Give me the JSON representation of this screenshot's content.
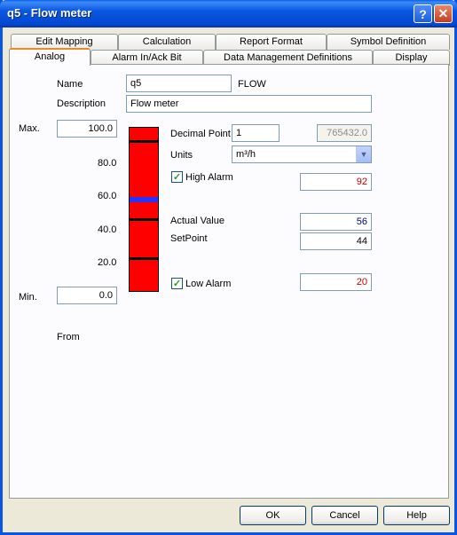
{
  "window": {
    "title": "q5 - Flow meter"
  },
  "tabs_row1": [
    {
      "label": "Edit Mapping"
    },
    {
      "label": "Calculation"
    },
    {
      "label": "Report Format"
    },
    {
      "label": "Symbol Definition"
    }
  ],
  "tabs_row2": [
    {
      "label": "Analog",
      "active": true
    },
    {
      "label": "Alarm In/Ack Bit"
    },
    {
      "label": "Data Management Definitions"
    },
    {
      "label": "Display"
    }
  ],
  "form": {
    "name_label": "Name",
    "name_value": "q5",
    "name_suffix": "FLOW",
    "description_label": "Description",
    "description_value": "Flow meter",
    "max_label": "Max.",
    "max_value": "100.0",
    "min_label": "Min.",
    "min_value": "0.0",
    "scale_ticks": [
      "80.0",
      "60.0",
      "40.0",
      "20.0"
    ],
    "decimal_point_label": "Decimal Point",
    "decimal_point_value": "1",
    "decimal_preview": "765432.0",
    "units_label": "Units",
    "units_value": "m³/h",
    "high_alarm_label": "High Alarm",
    "high_alarm_checked": true,
    "high_alarm_value": "92",
    "actual_value_label": "Actual Value",
    "actual_value": "56",
    "setpoint_label": "SetPoint",
    "setpoint_value": "44",
    "low_alarm_label": "Low Alarm",
    "low_alarm_checked": true,
    "low_alarm_value": "20",
    "from_label": "From"
  },
  "gauge": {
    "max": 100,
    "min": 0,
    "high_alarm": 92,
    "actual": 56,
    "setpoint": 44,
    "low_alarm": 20,
    "fill_color": "#ff0000",
    "actual_marker_color": "#2733ff"
  },
  "buttons": {
    "ok": "OK",
    "cancel": "Cancel",
    "help": "Help"
  },
  "colors": {
    "alarm_text": "#c00000",
    "actual_text": "#00008b",
    "title_bar": "#0957e1"
  }
}
